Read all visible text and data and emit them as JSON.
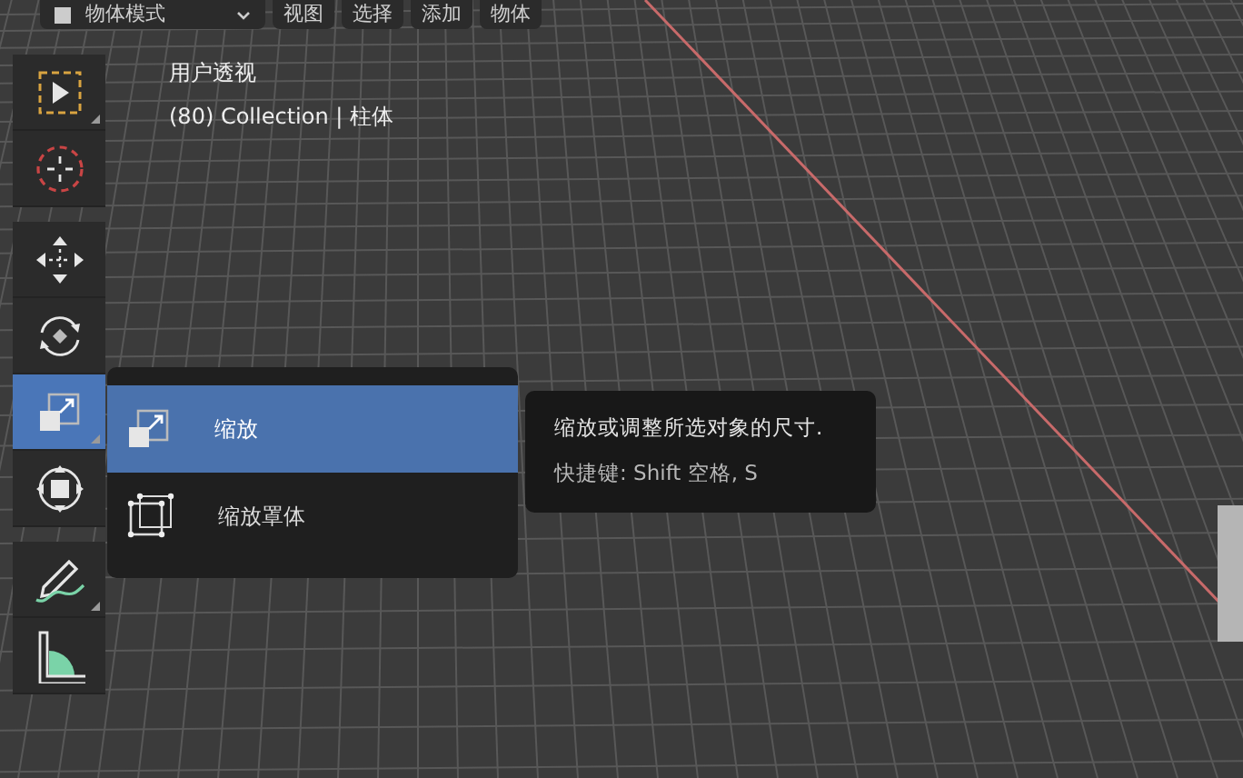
{
  "header": {
    "mode_menu": "物体模式",
    "menus": [
      "视图",
      "选择",
      "添加",
      "物体"
    ]
  },
  "viewport": {
    "view_name": "用户透视",
    "collection_info": "(80) Collection | 柱体"
  },
  "toolbar": {
    "groups": [
      {
        "tools": [
          {
            "kind": "select",
            "selected": false,
            "has_more": true
          },
          {
            "kind": "cursor",
            "selected": false,
            "has_more": false
          }
        ]
      },
      {
        "tools": [
          {
            "kind": "move",
            "selected": false,
            "has_more": false
          },
          {
            "kind": "rotate",
            "selected": false,
            "has_more": false
          },
          {
            "kind": "scale",
            "selected": true,
            "has_more": true
          },
          {
            "kind": "transform",
            "selected": false,
            "has_more": false
          }
        ]
      },
      {
        "tools": [
          {
            "kind": "annotate",
            "selected": false,
            "has_more": true
          },
          {
            "kind": "measure",
            "selected": false,
            "has_more": false
          }
        ]
      }
    ]
  },
  "popup_menu": {
    "items": [
      {
        "label": "缩放",
        "kind": "scale",
        "selected": true
      },
      {
        "label": "缩放罩体",
        "kind": "cage",
        "selected": false
      }
    ]
  },
  "tooltip": {
    "description": "缩放或调整所选对象的尺寸.",
    "shortcut": "快捷键: Shift 空格, S"
  }
}
